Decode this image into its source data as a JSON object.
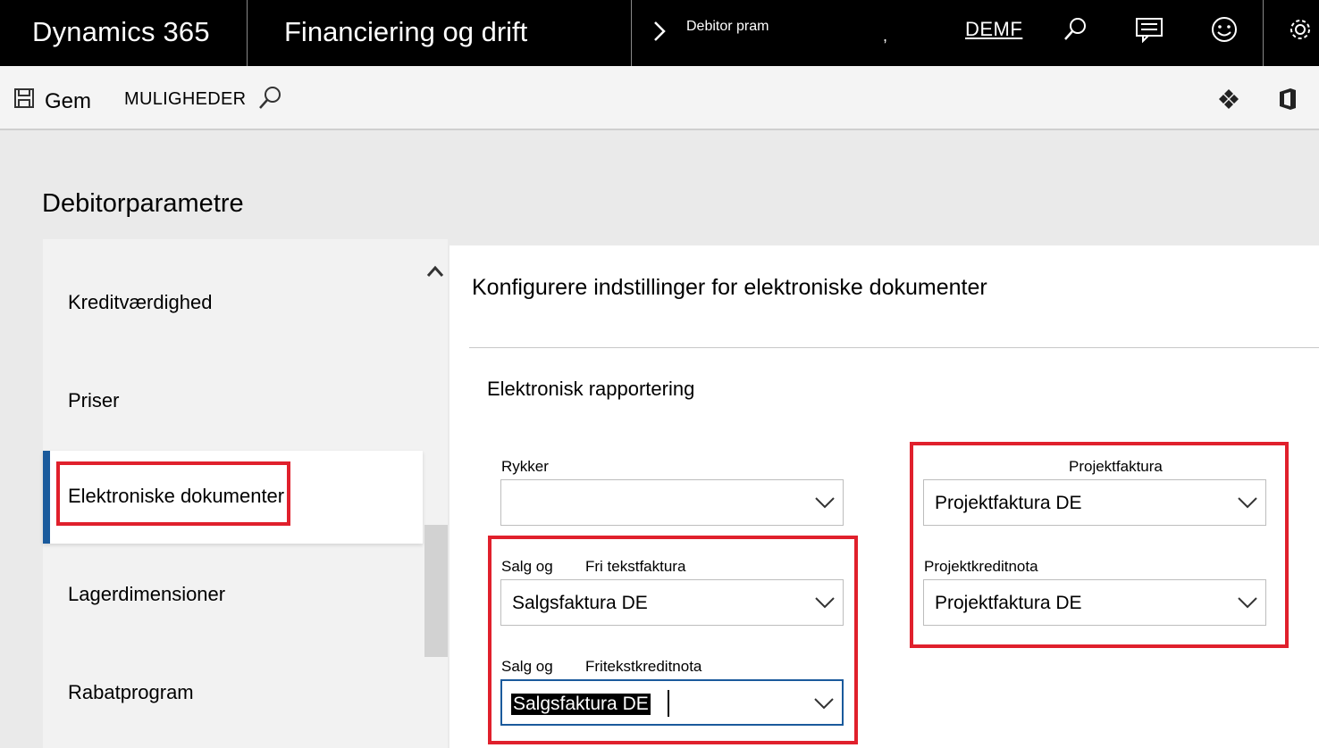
{
  "topbar": {
    "brand": "Dynamics 365",
    "module": "Financiering og drift",
    "breadcrumb": "Debitor pram",
    "separator": ",",
    "company": "DEMF",
    "icons": [
      "search-icon",
      "message-icon",
      "smiley-icon",
      "gear-icon"
    ]
  },
  "actionbar": {
    "save_label": "Gem",
    "options_label": "MULIGHEDER",
    "icons": [
      "save-icon",
      "search-icon",
      "diamond-grid-icon",
      "office-icon"
    ]
  },
  "page": {
    "title": "Debitorparametre"
  },
  "leftnav": {
    "items": [
      {
        "label": "Kreditværdighed"
      },
      {
        "label": "Priser"
      },
      {
        "label": "Elektroniske dokumenter"
      },
      {
        "label": "Lagerdimensioner"
      },
      {
        "label": "Rabatprogram"
      }
    ],
    "selected_index": 2
  },
  "content": {
    "section_title": "Konfigurere indstillinger for elektroniske dokumenter",
    "subsection_title": "Elektronisk rapportering",
    "fields": {
      "rykker": {
        "label": "Rykker",
        "value": ""
      },
      "salg_fri": {
        "label_a": "Salg og",
        "label_b": "Fri tekstfaktura",
        "value": "Salgsfaktura DE"
      },
      "salg_kredit": {
        "label_a": "Salg og",
        "label_b": "Fritekstkreditnota",
        "value": "Salgsfaktura DE"
      },
      "projektfaktura": {
        "label": "Projektfaktura",
        "value": "Projektfaktura DE"
      },
      "projektkreditnota": {
        "label": "Projektkreditnota",
        "value": "Projektfaktura DE"
      }
    }
  },
  "colors": {
    "topbar_bg": "#000000",
    "accent": "#1a5a9c",
    "highlight": "#e0202c"
  }
}
